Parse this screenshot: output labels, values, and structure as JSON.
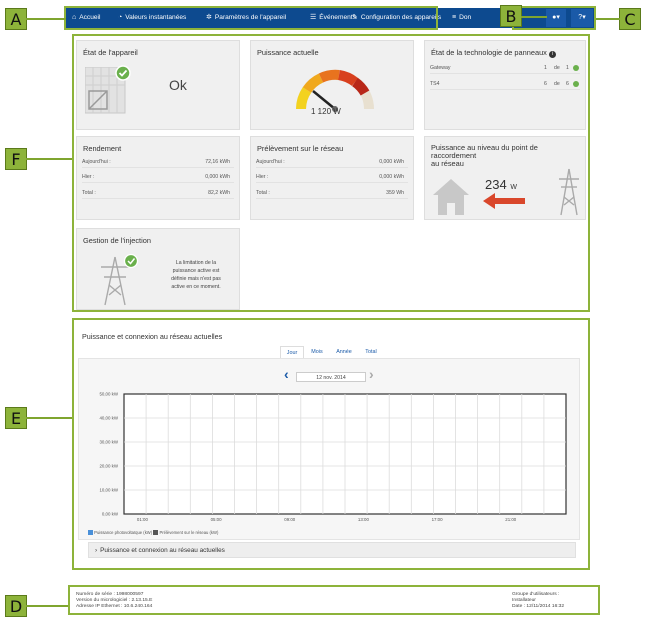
{
  "callouts": {
    "A": "A",
    "B": "B",
    "C": "C",
    "D": "D",
    "E": "E",
    "F": "F"
  },
  "nav": {
    "items": [
      {
        "label": "Accueil",
        "icon": "home-icon"
      },
      {
        "label": "Valeurs instantanées",
        "icon": "gauge-icon"
      },
      {
        "label": "Paramètres de l'appareil",
        "icon": "gear-icon"
      },
      {
        "label": "Événements",
        "icon": "list-icon"
      },
      {
        "label": "Configuration des appareils",
        "icon": "wrench-icon"
      },
      {
        "label": "Don",
        "icon": "database-icon"
      }
    ],
    "user_menu": "▾",
    "help_menu": "▾"
  },
  "cards": {
    "device_state": {
      "title": "État de l'appareil",
      "status": "Ok"
    },
    "current_power": {
      "title": "Puissance actuelle",
      "value": "1 120 W"
    },
    "panel_tech": {
      "title": "État de la technologie de panneaux",
      "rows": [
        {
          "label": "Gateway",
          "a": "1",
          "de": "de",
          "b": "1"
        },
        {
          "label": "TS4",
          "a": "6",
          "de": "de",
          "b": "6"
        }
      ]
    },
    "yield": {
      "title": "Rendement",
      "rows": [
        {
          "label": "Aujourd'hui :",
          "value": "72,16 kWh"
        },
        {
          "label": "Hier :",
          "value": "0,000 kWh"
        },
        {
          "label": "Total :",
          "value": "82,2 kWh"
        }
      ]
    },
    "grid_draw": {
      "title": "Prélèvement sur le réseau",
      "rows": [
        {
          "label": "Aujourd'hui :",
          "value": "0,000 kWh"
        },
        {
          "label": "Hier :",
          "value": "0,000 kWh"
        },
        {
          "label": "Total :",
          "value": "359 Wh"
        }
      ]
    },
    "grid_point": {
      "title_line1": "Puissance au niveau du point de raccordement",
      "title_line2": "au réseau",
      "value": "234",
      "unit": "W"
    },
    "feed_in": {
      "title": "Gestion de l'injection",
      "text1": "La limitation de la",
      "text2": "puissance active est",
      "text3": "définie mais n'est pas",
      "text4": "active en ce moment."
    }
  },
  "chart_section": {
    "title": "Puissance et connexion au réseau actuelles",
    "tabs": [
      "Jour",
      "Mois",
      "Année",
      "Total"
    ],
    "date": "12 nov. 2014",
    "legend1": "Puissance photovoltaïque (kW)",
    "legend2": "Prélèvement sur le réseau (kW)",
    "expander": "Puissance et connexion au réseau actuelles"
  },
  "chart_data": {
    "type": "area",
    "x_ticks": [
      "01:00",
      "05:00",
      "09:00",
      "13:00",
      "17:00",
      "21:00"
    ],
    "y_ticks": [
      "50,00 kW",
      "40,00 kW",
      "30,00 kW",
      "20,00 kW",
      "10,00 kW",
      "0,00 kW"
    ],
    "ylim": [
      0,
      50
    ],
    "grid": true,
    "series": [
      {
        "name": "Puissance photovoltaïque (kW)",
        "color": "#4a90d9",
        "values": []
      },
      {
        "name": "Prélèvement sur le réseau (kW)",
        "color": "#555555",
        "values": []
      }
    ]
  },
  "footer": {
    "serial": "Numéro de série : 1998000597",
    "firmware": "Version du micrologiciel : 2.13.15.E",
    "ip": "Adresse IP Ethernet : 10.6.240.164",
    "group_label": "Groupe d'utilisateurs :",
    "group": "Installateur",
    "date": "Date : 12/11/2014 16:32"
  },
  "colors": {
    "accent": "#8db33a",
    "nav": "#0d4a8f",
    "ok": "#6ab04c",
    "arrow": "#d9472b"
  }
}
